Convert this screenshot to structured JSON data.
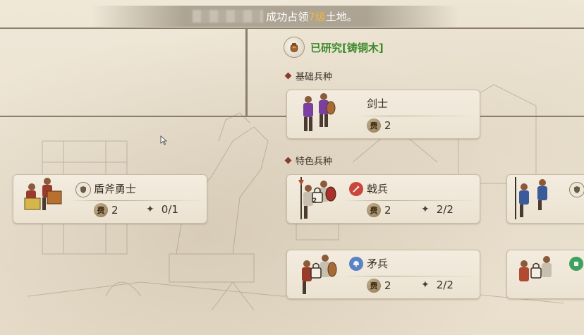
{
  "notice": {
    "prefix": "成功占领",
    "highlight": "7级",
    "suffix": "土地。"
  },
  "tech": {
    "label": "已研究[铸铜木]",
    "icon": "bronze-pot-icon"
  },
  "sections": {
    "basic": "基础兵种",
    "special": "特色兵种"
  },
  "units": {
    "swordsman": {
      "name": "剑士",
      "cost_icon": "费",
      "cost": "2"
    },
    "shield_axe": {
      "name": "盾斧勇士",
      "cost_icon": "费",
      "cost": "2",
      "count": "0/1",
      "type_icon": "shield-icon"
    },
    "halberd": {
      "name": "戟兵",
      "cost_icon": "费",
      "cost": "2",
      "count": "2/2",
      "type_icon": "sword-icon",
      "lock_badge": "2"
    },
    "spear": {
      "name": "矛兵",
      "cost_icon": "费",
      "cost": "2",
      "count": "2/2",
      "type_icon": "helmet-icon"
    }
  },
  "colors": {
    "tech_green": "#3d8a2c",
    "card_bg": "#f3ecdf",
    "highlight": "#f0b640",
    "sword_red": "#c9473a",
    "helmet_blue": "#5a82c4"
  }
}
